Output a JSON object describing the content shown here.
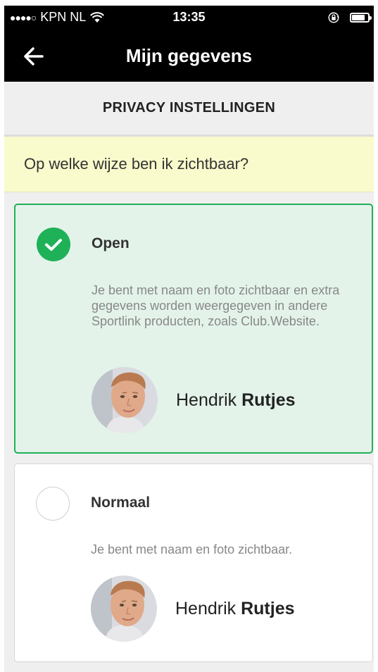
{
  "status_bar": {
    "signal": "●●●●○",
    "carrier": "KPN NL",
    "wifi_icon": "wifi-icon",
    "time": "13:35",
    "lock_icon": "rotation-lock-icon",
    "battery_icon": "battery-icon"
  },
  "nav": {
    "back_icon": "arrow-left-icon",
    "title": "Mijn gegevens"
  },
  "section_header": "PRIVACY INSTELLINGEN",
  "question": "Op welke wijze ben ik zichtbaar?",
  "options": [
    {
      "title": "Open",
      "selected": true,
      "description": "Je bent met naam en foto zichtbaar en extra gegevens worden weergegeven in andere Sportlink producten, zoals Club.Website.",
      "profile": {
        "first_name": "Hendrik",
        "last_name": "Rutjes"
      }
    },
    {
      "title": "Normaal",
      "selected": false,
      "description": "Je bent met naam en foto zichtbaar.",
      "profile": {
        "first_name": "Hendrik",
        "last_name": "Rutjes"
      }
    }
  ],
  "colors": {
    "accent_green": "#1fb158",
    "selected_card_bg": "#e3f3ea",
    "question_bg": "#f9fbcc",
    "bar_bg": "#000000"
  }
}
